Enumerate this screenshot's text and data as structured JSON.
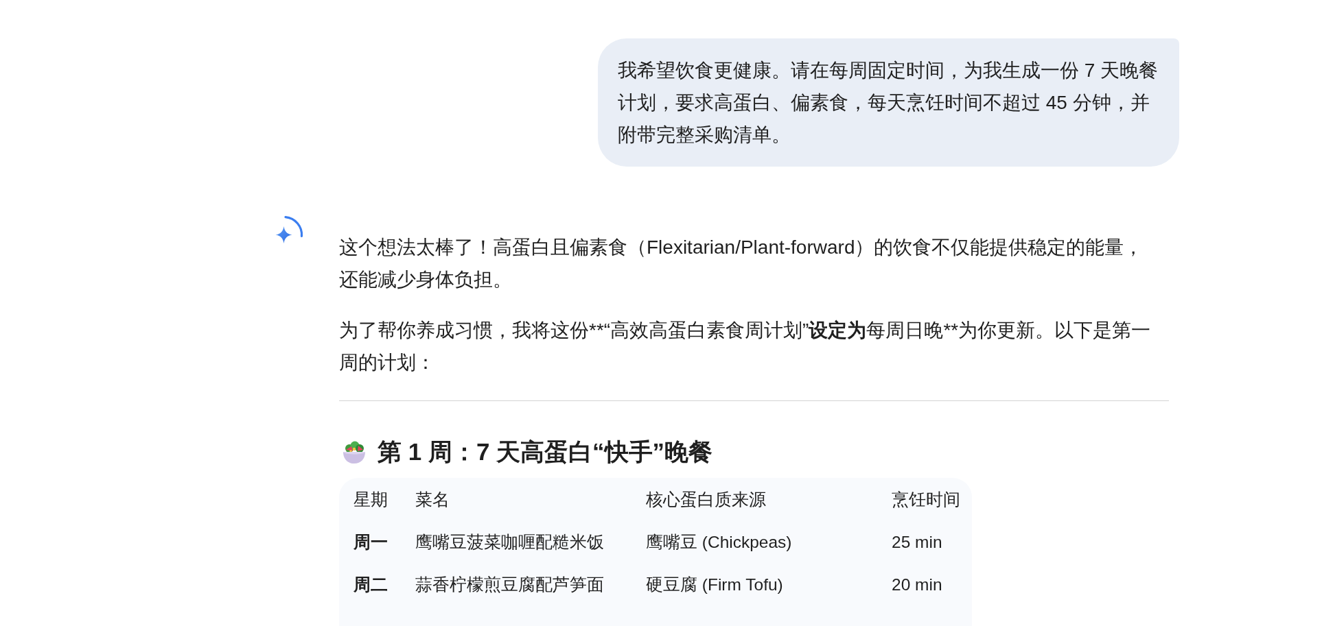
{
  "user_message": {
    "text": "我希望饮食更健康。请在每周固定时间，为我生成一份 7 天晚餐计划，要求高蛋白、偏素食，每天烹饪时间不超过 45 分钟，并附带完整采购清单。"
  },
  "response": {
    "paragraphs": [
      {
        "segments": [
          {
            "text": "这个想法太棒了！高蛋白且偏素食（Flexitarian/Plant-forward）的饮食不仅能提供稳定的能量，还能减少身体负担。",
            "bold": false
          }
        ]
      },
      {
        "segments": [
          {
            "text": "为了帮你养成习惯，我将这份**“高效高蛋白素食周计划”",
            "bold": false
          },
          {
            "text": "设定为",
            "bold": true
          },
          {
            "text": "每周日晚**为你更新。以下是第一周的计划：",
            "bold": false
          }
        ]
      }
    ],
    "section_heading": "第 1 周：7 天高蛋白“快手”晚餐",
    "table": {
      "columns": [
        "星期",
        "菜名",
        "核心蛋白质来源",
        "烹饪时间"
      ],
      "rows": [
        [
          "周一",
          "鹰嘴豆菠菜咖喱配糙米饭",
          "鹰嘴豆 (Chickpeas)",
          "25 min"
        ],
        [
          "周二",
          "蒜香柠檬煎豆腐配芦笋面",
          "硬豆腐 (Firm Tofu)",
          "20 min"
        ]
      ]
    }
  }
}
